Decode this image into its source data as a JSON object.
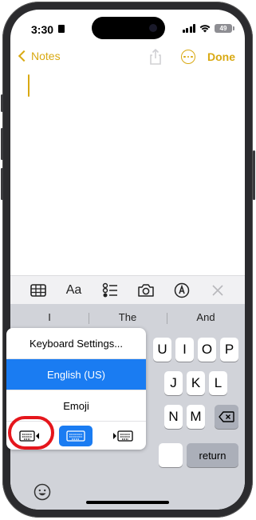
{
  "status": {
    "time": "3:30",
    "battery": "49"
  },
  "nav": {
    "back_label": "Notes",
    "done_label": "Done"
  },
  "toolbar": {
    "icons": [
      "table-icon",
      "text-format-icon",
      "checklist-icon",
      "camera-icon",
      "markup-icon",
      "close-icon"
    ],
    "format_label": "Aa"
  },
  "predictions": [
    "I",
    "The",
    "And"
  ],
  "keys": {
    "row1": [
      "U",
      "I",
      "O",
      "P"
    ],
    "row2": [
      "J",
      "K",
      "L"
    ],
    "row3": [
      "N",
      "M"
    ],
    "return_label": "return"
  },
  "popup": {
    "settings_label": "Keyboard Settings...",
    "english_label": "English (US)",
    "emoji_label": "Emoji"
  },
  "colors": {
    "accent": "#d9a912",
    "selected": "#1a7cf2",
    "highlight_ring": "#e5161c"
  }
}
